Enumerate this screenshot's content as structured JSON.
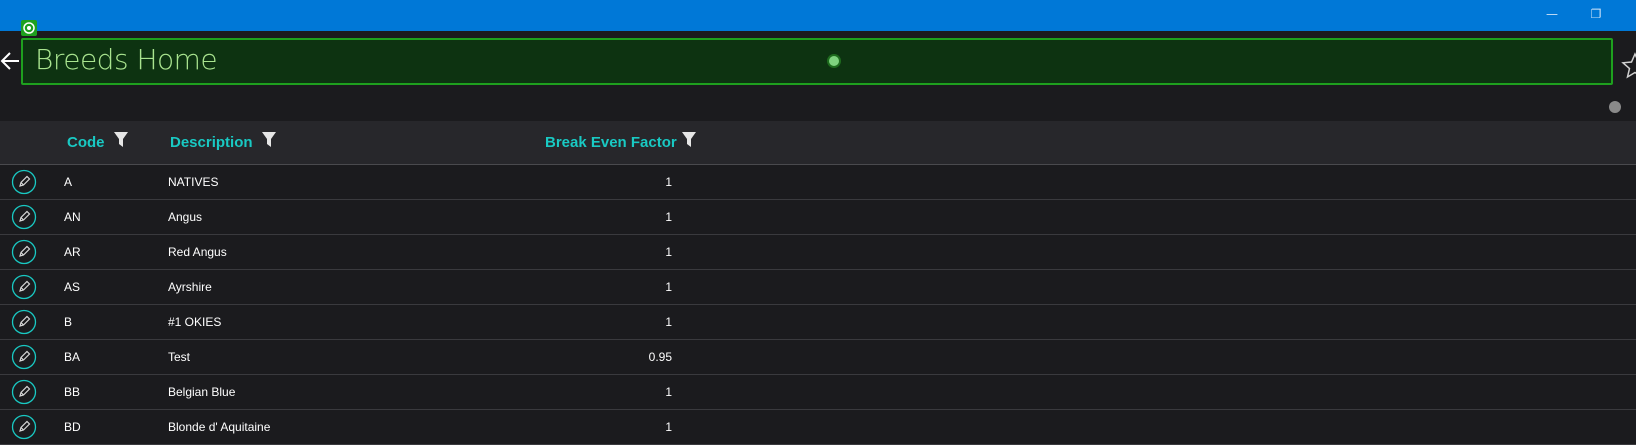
{
  "window": {
    "minimize_glyph": "—",
    "restore_glyph": "❐"
  },
  "header": {
    "title": "Breeds Home",
    "back_icon": "back-arrow-icon",
    "favorite_icon": "star-icon",
    "more_icon": "more-dots-icon"
  },
  "colors": {
    "titlebar": "#0078d7",
    "accent": "#19c9c3",
    "title_box_bg": "#0d3311",
    "title_box_border": "#1ea01e",
    "title_text": "#a9e48f"
  },
  "grid": {
    "columns": [
      {
        "label": "Code",
        "filter_icon": "filter-icon"
      },
      {
        "label": "Description",
        "filter_icon": "filter-icon"
      },
      {
        "label": "Break Even Factor",
        "filter_icon": "filter-icon"
      }
    ],
    "rows": [
      {
        "code": "A",
        "description": "NATIVES",
        "factor": "1"
      },
      {
        "code": "AN",
        "description": "Angus",
        "factor": "1"
      },
      {
        "code": "AR",
        "description": "Red Angus",
        "factor": "1"
      },
      {
        "code": "AS",
        "description": "Ayrshire",
        "factor": "1"
      },
      {
        "code": "B",
        "description": "#1 OKIES",
        "factor": "1"
      },
      {
        "code": "BA",
        "description": "Test",
        "factor": "0.95"
      },
      {
        "code": "BB",
        "description": "Belgian Blue",
        "factor": "1"
      },
      {
        "code": "BD",
        "description": "Blonde d' Aquitaine",
        "factor": "1"
      }
    ]
  }
}
